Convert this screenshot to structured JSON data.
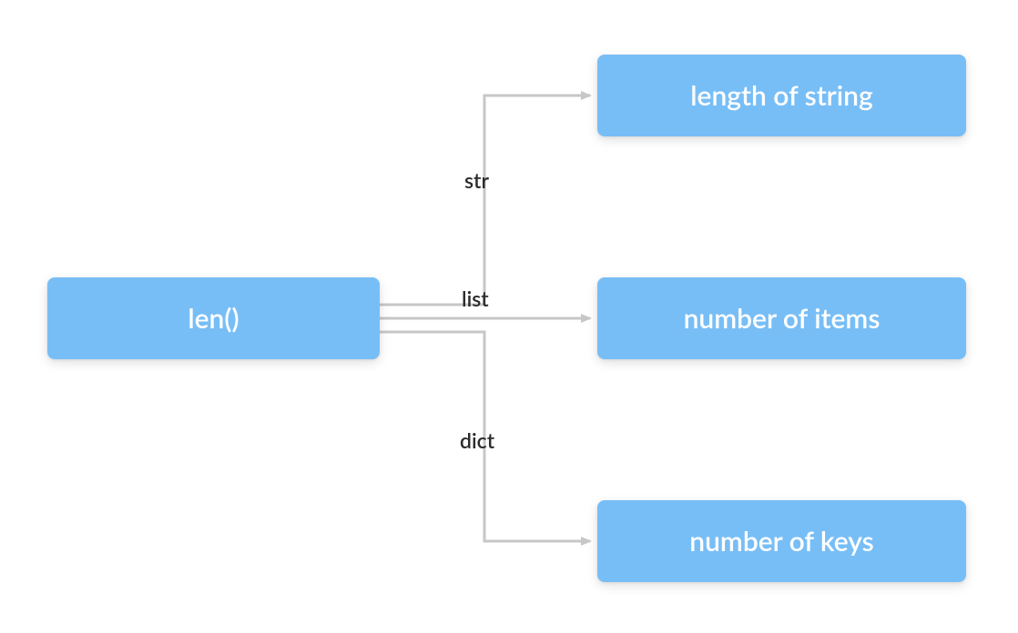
{
  "source": {
    "label": "len()"
  },
  "targets": [
    {
      "label": "length of string"
    },
    {
      "label": "number of items"
    },
    {
      "label": "number of keys"
    }
  ],
  "edges": [
    {
      "label": "str"
    },
    {
      "label": "list"
    },
    {
      "label": "dict"
    }
  ],
  "colors": {
    "node_bg": "#78bef6",
    "node_text": "#ffffff",
    "edge_stroke": "#c7c7c7",
    "label_text": "#2c2c2c"
  }
}
